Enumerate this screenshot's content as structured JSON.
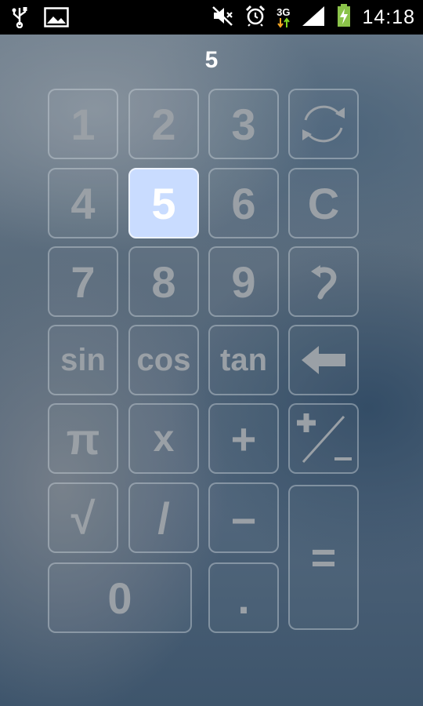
{
  "status_bar": {
    "time": "14:18",
    "network": "3G",
    "left_icons": [
      "usb-icon",
      "image-icon"
    ],
    "right_icons": [
      "mute-icon",
      "alarm-icon",
      "network-3g-icon",
      "signal-icon",
      "battery-charging-icon"
    ]
  },
  "display": {
    "value": "5"
  },
  "keys": {
    "one": "1",
    "two": "2",
    "three": "3",
    "rotate": "rotate-icon",
    "four": "4",
    "five": "5",
    "six": "6",
    "clear": "C",
    "seven": "7",
    "eight": "8",
    "nine": "9",
    "undo": "undo-icon",
    "sin": "sin",
    "cos": "cos",
    "tan": "tan",
    "backspace": "backspace-arrow-icon",
    "pi": "π",
    "multiply": "x",
    "plus": "+",
    "plus_minus": "plus-minus-icon",
    "sqrt": "√",
    "divide": "/",
    "minus": "−",
    "equals": "=",
    "zero": "0",
    "dot": "."
  },
  "active_key": "five",
  "colors": {
    "key_text": "#9aa0a6",
    "active_key_bg": "#c9dcff",
    "status_bar_bg": "#000000"
  }
}
